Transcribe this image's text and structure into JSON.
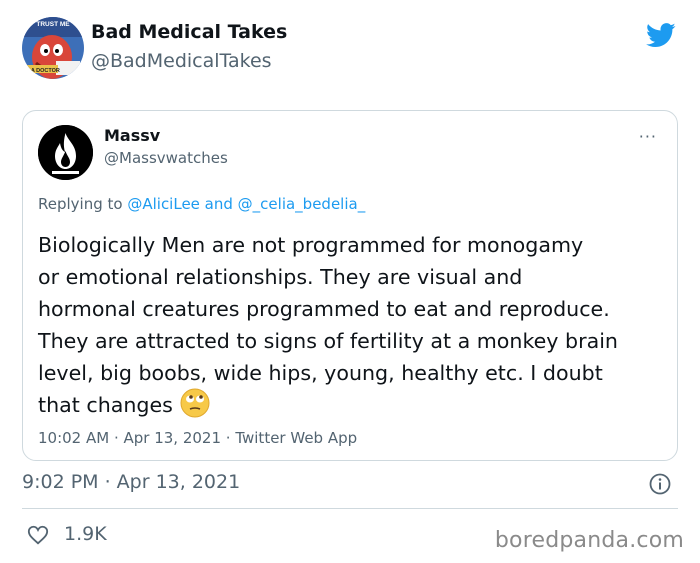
{
  "outer_tweet": {
    "name": "Bad Medical Takes",
    "handle": "@BadMedicalTakes",
    "avatar_caption_top": "TRUST ME",
    "avatar_caption_bottom": "I'M A DOCTOR",
    "timestamp": "9:02 PM · Apr 13, 2021",
    "like_count": "1.9K"
  },
  "quoted_tweet": {
    "name": "Massv",
    "handle": "@Massvwatches",
    "more_label": "···",
    "replying_prefix": "Replying to ",
    "replying_mention_1": "@AliciLee",
    "replying_and": " and ",
    "replying_mention_2": "@_celia_bedelia_",
    "body_lines": [
      "Biologically Men are not programmed for monogamy",
      "or emotional relationships. They are visual and",
      "hormonal creatures programmed to eat and reproduce.",
      "They are attracted to signs of fertility at a monkey brain",
      "level, big boobs, wide hips, young, healthy etc. I doubt",
      "that changes"
    ],
    "emoji": "eye-roll-emoji",
    "meta": "10:02 AM · Apr 13, 2021 · Twitter Web App"
  },
  "icons": {
    "twitter": "twitter-bird-icon",
    "info": "info-icon",
    "like": "heart-icon"
  },
  "colors": {
    "twitter_blue": "#1d9bf0",
    "secondary_text": "#536471",
    "border": "#cfd9de"
  },
  "watermark": "boredpanda.com"
}
